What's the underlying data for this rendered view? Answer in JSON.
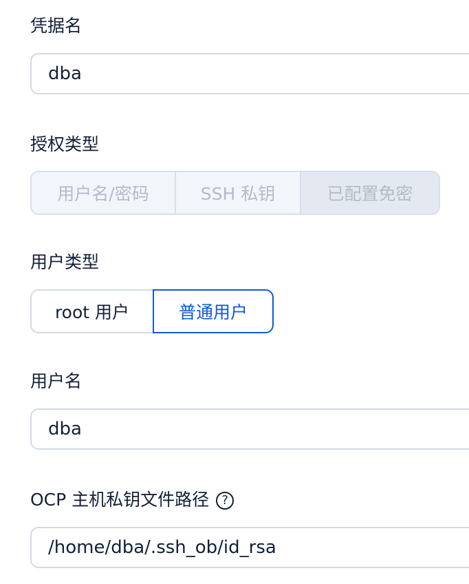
{
  "credential": {
    "label": "凭据名",
    "value": "dba"
  },
  "auth_type": {
    "label": "授权类型",
    "options": [
      "用户名/密码",
      "SSH 私钥",
      "已配置免密"
    ],
    "selected": "已配置免密",
    "disabled": true
  },
  "user_type": {
    "label": "用户类型",
    "options": [
      "root 用户",
      "普通用户"
    ],
    "selected": "普通用户"
  },
  "username": {
    "label": "用户名",
    "value": "dba"
  },
  "key_path": {
    "label": "OCP 主机私钥文件路径",
    "help_icon_glyph": "?",
    "value": "/home/dba/.ssh_ob/id_rsa"
  },
  "colors": {
    "text": "#132039",
    "border": "#d4d9e6",
    "disabled_bg": "#f2f5fa",
    "disabled_text": "#b3bccb",
    "accent": "#0e5ad8"
  }
}
